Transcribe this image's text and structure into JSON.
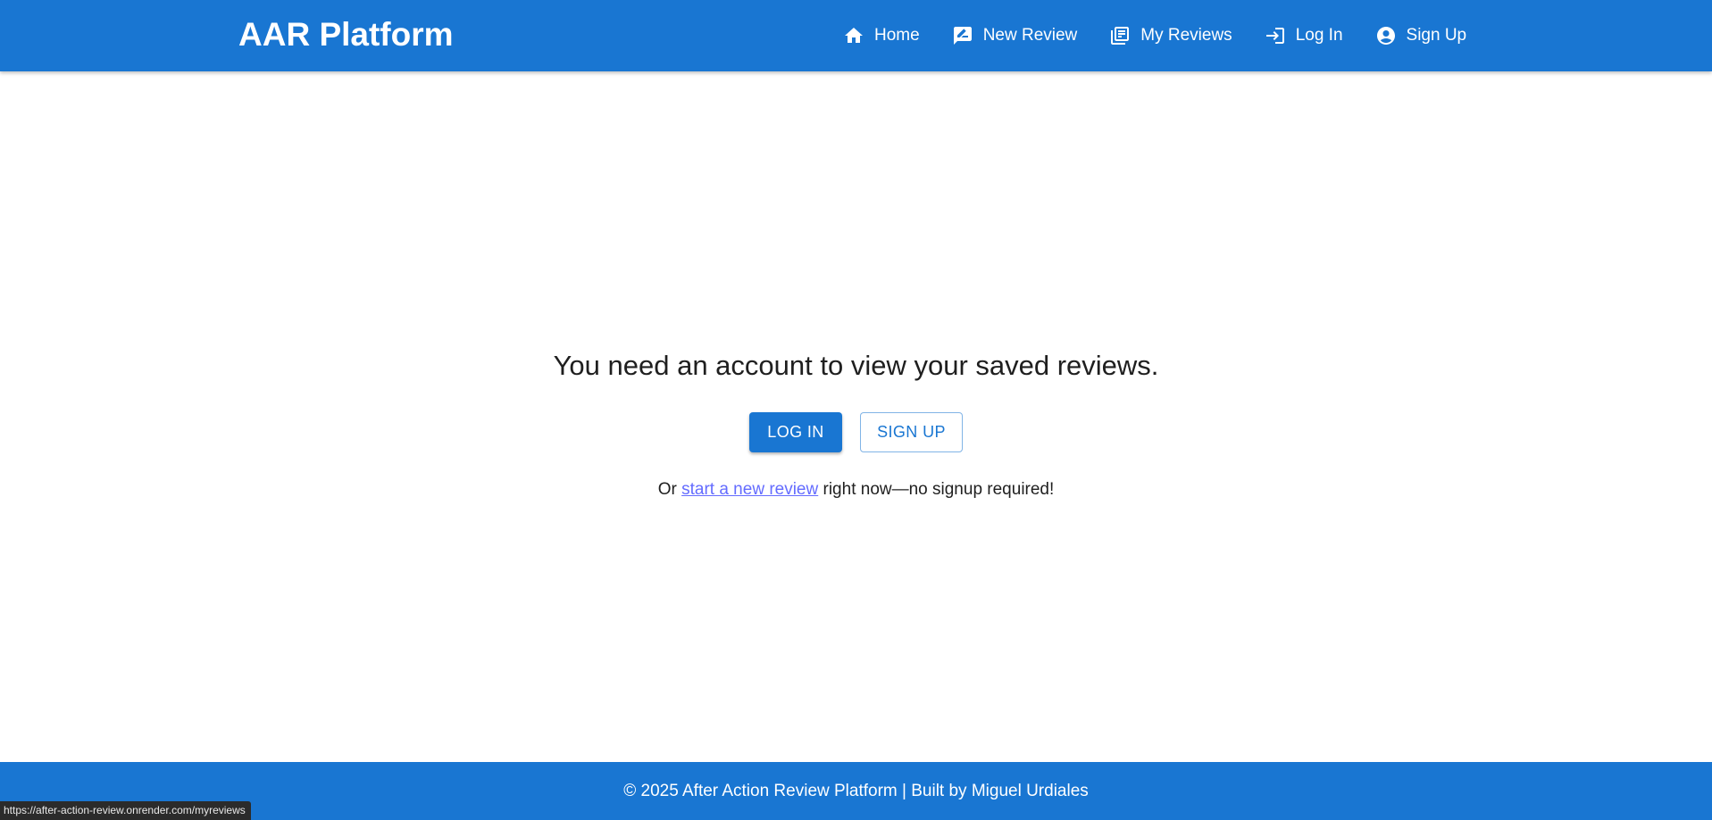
{
  "header": {
    "brand": "AAR Platform",
    "nav": [
      {
        "label": "Home",
        "icon": "home-icon"
      },
      {
        "label": "New Review",
        "icon": "rate-review-icon"
      },
      {
        "label": "My Reviews",
        "icon": "library-books-icon"
      },
      {
        "label": "Log In",
        "icon": "login-icon"
      },
      {
        "label": "Sign Up",
        "icon": "account-circle-icon"
      }
    ]
  },
  "main": {
    "message": "You need an account to view your saved reviews.",
    "login_button": "LOG IN",
    "signup_button": "SIGN UP",
    "subline_prefix": "Or ",
    "subline_link": "start a new review",
    "subline_suffix": " right now—no signup required!"
  },
  "footer": {
    "text": "© 2025 After Action Review Platform | Built by Miguel Urdiales"
  },
  "status_bar": {
    "url": "https://after-action-review.onrender.com/myreviews"
  },
  "colors": {
    "primary": "#1976d2",
    "link": "#646cff"
  }
}
